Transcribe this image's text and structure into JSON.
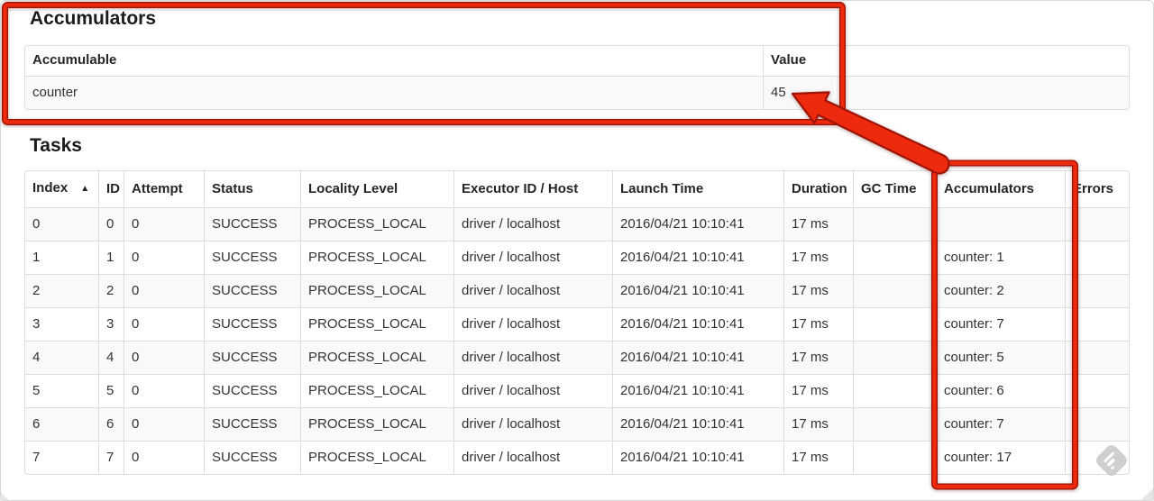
{
  "accumulators_section": {
    "title": "Accumulators",
    "table": {
      "headers": [
        "Accumulable",
        "Value"
      ],
      "rows": [
        [
          "counter",
          "45"
        ]
      ]
    }
  },
  "tasks_section": {
    "title": "Tasks",
    "table": {
      "headers": [
        "Index",
        "ID",
        "Attempt",
        "Status",
        "Locality Level",
        "Executor ID / Host",
        "Launch Time",
        "Duration",
        "GC Time",
        "Accumulators",
        "Errors"
      ],
      "sort": {
        "column": "Index",
        "direction": "ascending",
        "indicator": "▲"
      },
      "rows": [
        [
          "0",
          "0",
          "0",
          "SUCCESS",
          "PROCESS_LOCAL",
          "driver / localhost",
          "2016/04/21 10:10:41",
          "17 ms",
          "",
          "",
          ""
        ],
        [
          "1",
          "1",
          "0",
          "SUCCESS",
          "PROCESS_LOCAL",
          "driver / localhost",
          "2016/04/21 10:10:41",
          "17 ms",
          "",
          "counter: 1",
          ""
        ],
        [
          "2",
          "2",
          "0",
          "SUCCESS",
          "PROCESS_LOCAL",
          "driver / localhost",
          "2016/04/21 10:10:41",
          "17 ms",
          "",
          "counter: 2",
          ""
        ],
        [
          "3",
          "3",
          "0",
          "SUCCESS",
          "PROCESS_LOCAL",
          "driver / localhost",
          "2016/04/21 10:10:41",
          "17 ms",
          "",
          "counter: 7",
          ""
        ],
        [
          "4",
          "4",
          "0",
          "SUCCESS",
          "PROCESS_LOCAL",
          "driver / localhost",
          "2016/04/21 10:10:41",
          "17 ms",
          "",
          "counter: 5",
          ""
        ],
        [
          "5",
          "5",
          "0",
          "SUCCESS",
          "PROCESS_LOCAL",
          "driver / localhost",
          "2016/04/21 10:10:41",
          "17 ms",
          "",
          "counter: 6",
          ""
        ],
        [
          "6",
          "6",
          "0",
          "SUCCESS",
          "PROCESS_LOCAL",
          "driver / localhost",
          "2016/04/21 10:10:41",
          "17 ms",
          "",
          "counter: 7",
          ""
        ],
        [
          "7",
          "7",
          "0",
          "SUCCESS",
          "PROCESS_LOCAL",
          "driver / localhost",
          "2016/04/21 10:10:41",
          "17 ms",
          "",
          "counter: 17",
          ""
        ]
      ]
    }
  },
  "annotations": {
    "highlight_color": "#ee2a0e",
    "edge_color": "#9e1404"
  }
}
